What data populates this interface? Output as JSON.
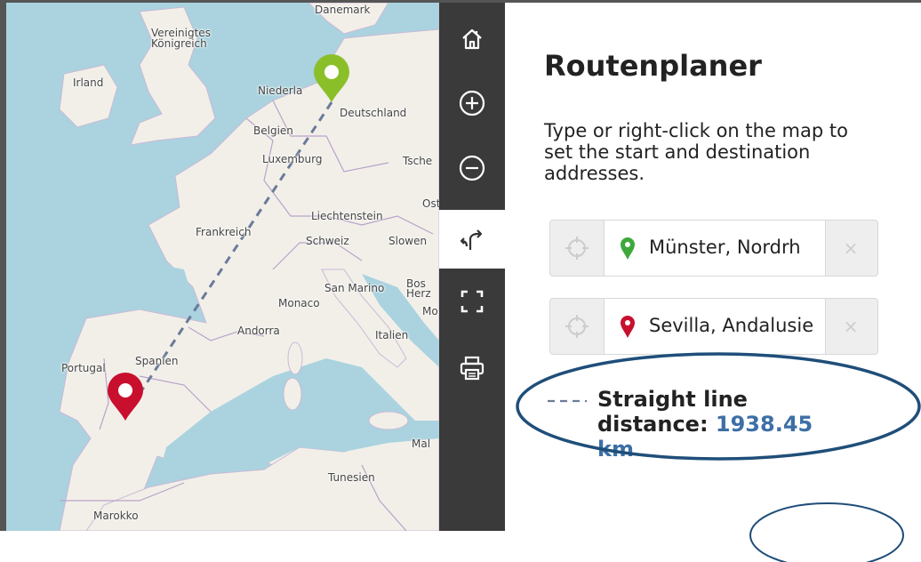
{
  "map": {
    "labels": {
      "danemark": "Danemark",
      "vereinigtes": "Vereinigtes",
      "konigreich": "Königreich",
      "irland": "Irland",
      "niederlande": "Niederla",
      "deutschland": "Deutschland",
      "belgien": "Belgien",
      "luxemburg": "Luxemburg",
      "tsche": "Tsche",
      "ost": "Ost",
      "liechtenstein": "Liechtenstein",
      "frankreich": "Frankreich",
      "schweiz": "Schweiz",
      "slowen": "Slowen",
      "sanmarino": "San Marino",
      "bos": "Bos",
      "herz": "Herz",
      "monaco": "Monaco",
      "mo": "Mo",
      "andorra": "Andorra",
      "italien": "Italien",
      "portugal": "Portugal",
      "spanien": "Spanien",
      "mal": "Mal",
      "tunesien": "Tunesien",
      "marokko": "Marokko"
    },
    "colors": {
      "sea": "#aad3df",
      "land": "#f2efe9",
      "route": "#6b7a99",
      "start_pin": "#8bbf2a",
      "end_pin": "#c8102e"
    }
  },
  "toolbar": {
    "items": [
      {
        "name": "home-icon"
      },
      {
        "name": "zoom-in-icon"
      },
      {
        "name": "zoom-out-icon"
      },
      {
        "name": "route-icon"
      },
      {
        "name": "fullscreen-icon"
      },
      {
        "name": "print-icon"
      }
    ],
    "active": "route-icon"
  },
  "panel": {
    "title": "Routenplaner",
    "description": "Type or right-click on the map to set the start and destination addresses.",
    "start": {
      "value": "Münster, Nordrh"
    },
    "destination": {
      "value": "Sevilla, Andalusie"
    },
    "clear_symbol": "×",
    "distance_label": "Straight line distance:",
    "distance_value": "1938.45 km"
  }
}
